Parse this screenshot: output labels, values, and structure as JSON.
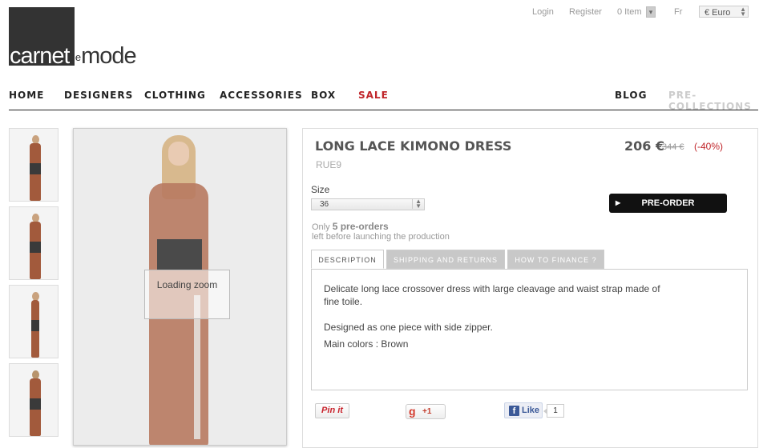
{
  "header": {
    "login": "Login",
    "register": "Register",
    "cart": "0 Item",
    "language": "Fr",
    "currency": "€ Euro"
  },
  "logo": {
    "part1": "carnet",
    "part2": "de",
    "part3": "mode"
  },
  "nav": {
    "home": "HOME",
    "designers": "DESIGNERS",
    "clothing": "CLOTHING",
    "accessories": "ACCESSORIES",
    "box": "BOX",
    "sale": "SALE",
    "blog": "BLOG",
    "pre_collections": "PRE-COLLECTIONS"
  },
  "colors": {
    "sale": "#c0252a",
    "dress": "#a25a3c",
    "button": "#111111"
  },
  "gallery": {
    "zoom_text": "Loading zoom"
  },
  "product": {
    "title": "LONG LACE KIMONO DRESS",
    "brand": "RUE9",
    "price": "206 €",
    "old_price": "344 €",
    "discount": "(-40%)",
    "size_label": "Size",
    "size_value": "36",
    "preorder_label": "PRE-ORDER",
    "only_text": "Only",
    "preorders_count": "5 pre-orders",
    "left_text": "left before launching the production"
  },
  "tabs": {
    "description": "DESCRIPTION",
    "shipping": "SHIPPING AND RETURNS",
    "finance": "HOW TO FINANCE ?"
  },
  "description": {
    "line1": "Delicate long lace crossover dress with large cleavage and waist strap made of fine toile.",
    "line2": "Designed as one piece with side zipper.",
    "line3": "Main colors : Brown"
  },
  "social": {
    "pinit": "Pin it",
    "gplus": "+1",
    "fb_like": "Like",
    "fb_count": "1"
  },
  "icons": [
    "dropdown-arrow-icon",
    "play-icon",
    "google-plus-icon",
    "facebook-icon"
  ]
}
